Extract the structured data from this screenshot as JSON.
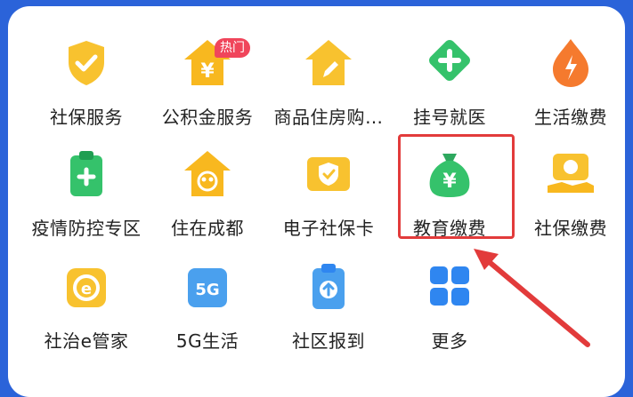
{
  "services": [
    {
      "id": "social-security-service",
      "label": "社保服务",
      "icon": "shield-check-icon",
      "color": "#f8c22f"
    },
    {
      "id": "housing-fund-service",
      "label": "公积金服务",
      "icon": "house-yen-icon",
      "color": "#f8b81f",
      "badge": "热门"
    },
    {
      "id": "commercial-housing",
      "label": "商品住房购…",
      "icon": "house-pencil-icon",
      "color": "#f8c22f"
    },
    {
      "id": "hospital-registration",
      "label": "挂号就医",
      "icon": "medical-plus-icon",
      "color": "#35c26b"
    },
    {
      "id": "utility-payment",
      "label": "生活缴费",
      "icon": "flame-bolt-icon",
      "color": "#f57a2e"
    },
    {
      "id": "epidemic-prevention",
      "label": "疫情防控专区",
      "icon": "medical-clipboard-icon",
      "color": "#35c26b"
    },
    {
      "id": "live-in-chengdu",
      "label": "住在成都",
      "icon": "house-family-icon",
      "color": "#f8b81f"
    },
    {
      "id": "electronic-social-card",
      "label": "电子社保卡",
      "icon": "card-shield-icon",
      "color": "#f8c22f"
    },
    {
      "id": "education-payment",
      "label": "教育缴费",
      "icon": "bag-yen-icon",
      "color": "#35c26b"
    },
    {
      "id": "social-insurance-payment",
      "label": "社保缴费",
      "icon": "hand-coin-icon",
      "color": "#f8c22f"
    },
    {
      "id": "community-steward",
      "label": "社治e管家",
      "icon": "e-badge-icon",
      "color": "#f8c22f"
    },
    {
      "id": "5g-life",
      "label": "5G生活",
      "icon": "5g-icon",
      "color": "#4aa0ee",
      "icon_text": "5G"
    },
    {
      "id": "community-report",
      "label": "社区报到",
      "icon": "clipboard-upload-icon",
      "color": "#4aa0ee"
    },
    {
      "id": "more",
      "label": "更多",
      "icon": "grid-icon",
      "color": "#2f86f0"
    }
  ],
  "highlighted_service": "教育缴费",
  "colors": {
    "top_bar": "#2b63d9",
    "panel": "#ffffff",
    "highlight": "#e23b3b"
  }
}
